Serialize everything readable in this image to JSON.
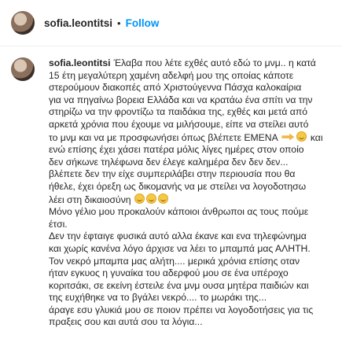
{
  "header": {
    "username": "sofia.leontitsi",
    "separator": "•",
    "follow_label": "Follow"
  },
  "post": {
    "author": "sofia.leontitsi",
    "lines": [
      "Έλαβα που λέτε εχθές αυτό εδώ το μνμ.. η κατά",
      "15 έτη μεγαλύτερη χαμένη αδελφή μου της οποίας κάποτε",
      "στερούμουν διακοπές από Χριστούγεννα Πάσχα καλοκαίρια",
      "για να πηγαίνω βορεια Ελλάδα και να κρατάω ένα σπίτι να την",
      "στηρίζω να την φροντίζω τα παιδάκια της, εχθές και μετά από",
      "αρκετά χρόνια που έχουμε να μιλήσουμε, είπε να στείλει αυτό",
      "το μνμ και να με προσφωνήσει όπως βλέπετε ΕΜΕΝΑ",
      "και",
      "ενώ επίσης έχει χάσει πατέρα μόλις λίγες ημέρες στον οποίο",
      "δεν σήκωνε τηλέφωνα δεν έλεγε καλημέρα δεν δεν δεν...",
      "βλέπετε δεν την είχε συμπεριλάβει στην περιουσία που θα",
      "ήθελε, έχει όρεξη ως δικομανής να με στείλει να λογοδοτησω",
      "λέει στη δικαιοσύνη",
      "Μόνο γέλιο μου προκαλούν κάποιοι άνθρωποι ας τους πούμε",
      "έτσι.",
      "Δεν την έφταιγε φυσικά αυτό αλλα έκανε και ενα τηλεφώνημα",
      "και χωρίς κανένα λόγο άρχισε να λέει το μπαμπά μας ΑΛΗΤΗ.",
      "Τον νεκρό μπαμπα μας αλήτη.... μερικά χρόνια επίσης οταν",
      "ήταν εγκυος η γυναίκα του αδερφού μου σε ένα υπέροχο",
      "κοριτσάκι, σε εκείνη έστειλε ένα μνμ ουσα μητέρα παιδιών και",
      "της ευχήθηκε να το βγάλει νεκρό.... το μωράκι της...",
      "άραγε εσυ γλυκιά μου σε ποιον πρέπει να λογοδοτήσεις για τις",
      "πραξεις σου και αυτά σου τα λόγια..."
    ]
  }
}
